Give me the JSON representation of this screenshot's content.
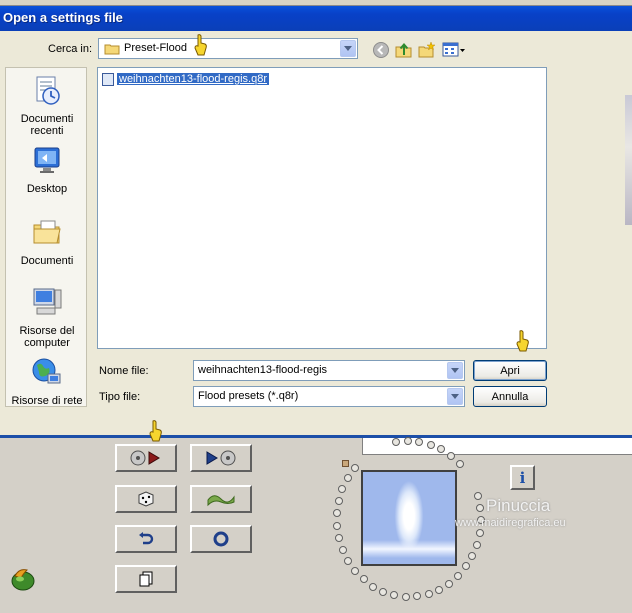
{
  "window": {
    "title": "Open a settings file"
  },
  "dialog": {
    "look_in_label": "Cerca in:",
    "look_in_value": "Preset-Flood",
    "places": [
      {
        "label_line1": "Documenti",
        "label_line2": "recenti",
        "icon": "recent-documents-icon"
      },
      {
        "label_line1": "Desktop",
        "label_line2": "",
        "icon": "desktop-icon"
      },
      {
        "label_line1": "Documenti",
        "label_line2": "",
        "icon": "my-documents-icon"
      },
      {
        "label_line1": "Risorse del",
        "label_line2": "computer",
        "icon": "my-computer-icon"
      },
      {
        "label_line1": "Risorse di rete",
        "label_line2": "",
        "icon": "network-places-icon"
      }
    ],
    "files": [
      {
        "name": "weihnachten13-flood-regis.q8r",
        "selected": true
      }
    ],
    "file_name_label": "Nome file:",
    "file_name_value": "weihnachten13-flood-regis",
    "file_type_label": "Tipo file:",
    "file_type_value": "Flood presets (*.q8r)",
    "open_button": "Apri",
    "cancel_button": "Annulla"
  },
  "watermark": {
    "name": "Pinuccia",
    "url": "www.maidiregrafica.eu"
  },
  "colors": {
    "titlebar": "#0a5fe8",
    "selection": "#316ac5",
    "panel_bg": "#d4d0c8",
    "dialog_bg": "#ece9d8"
  }
}
